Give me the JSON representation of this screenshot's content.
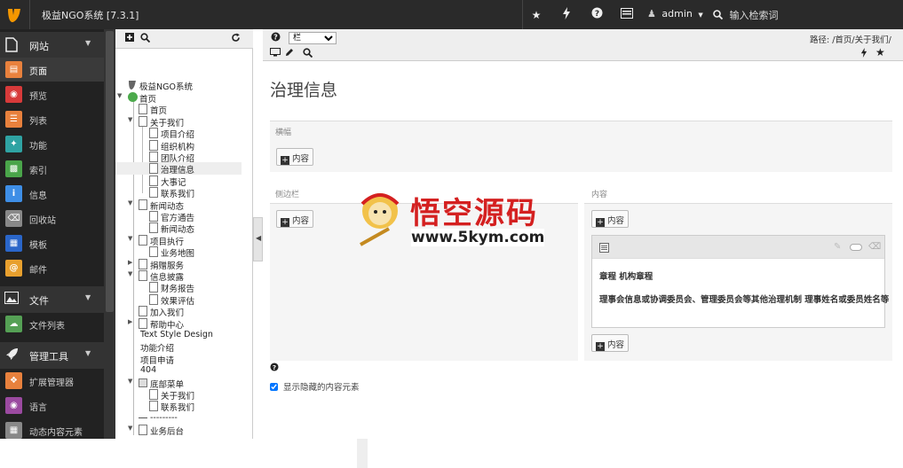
{
  "topbar": {
    "site_title": "极益NGO系统 [7.3.1]",
    "user_label": "admin",
    "search_placeholder": "输入检索词",
    "icons": [
      "star-icon",
      "bolt-icon",
      "help-icon",
      "list-icon",
      "user-icon",
      "search-icon"
    ]
  },
  "modules": {
    "groups": [
      {
        "label": "网站",
        "icon": "file-icon"
      },
      {
        "label": "文件",
        "icon": "image-icon"
      },
      {
        "label": "管理工具",
        "icon": "rocket-icon"
      }
    ],
    "items": [
      {
        "label": "页面",
        "icon": "page-icon",
        "color": "#e8813d",
        "active": true
      },
      {
        "label": "预览",
        "icon": "eye-icon",
        "color": "#d73a3a"
      },
      {
        "label": "列表",
        "icon": "list-icon",
        "color": "#e8813d"
      },
      {
        "label": "功能",
        "icon": "wand-icon",
        "color": "#2fa3a3"
      },
      {
        "label": "索引",
        "icon": "chart-icon",
        "color": "#4aa54a"
      },
      {
        "label": "信息",
        "icon": "info-icon",
        "color": "#3e8ee6"
      },
      {
        "label": "回收站",
        "icon": "trash-icon",
        "color": "#888888"
      },
      {
        "label": "模板",
        "icon": "template-icon",
        "color": "#2a66c9"
      },
      {
        "label": "邮件",
        "icon": "at-icon",
        "color": "#e8a02e"
      },
      {
        "label": "文件列表",
        "icon": "cloud-icon",
        "color": "#55a055"
      },
      {
        "label": "扩展管理器",
        "icon": "ext-icon",
        "color": "#e8813d"
      },
      {
        "label": "语言",
        "icon": "globe-icon",
        "color": "#9b4aa0"
      },
      {
        "label": "动态内容元素",
        "icon": "element-icon",
        "color": "#888888"
      }
    ]
  },
  "tree": {
    "root_label": "极益NGO系统",
    "nodes": [
      {
        "label": "首页"
      },
      {
        "label": "首页"
      },
      {
        "label": "关于我们"
      },
      {
        "label": "项目介绍"
      },
      {
        "label": "组织机构"
      },
      {
        "label": "团队介绍"
      },
      {
        "label": "治理信息"
      },
      {
        "label": "大事记"
      },
      {
        "label": "联系我们"
      },
      {
        "label": "新闻动态"
      },
      {
        "label": "官方通告"
      },
      {
        "label": "新闻动态"
      },
      {
        "label": "项目执行"
      },
      {
        "label": "业务地图"
      },
      {
        "label": "捐赠服务"
      },
      {
        "label": "信息披露"
      },
      {
        "label": "财务报告"
      },
      {
        "label": "效果评估"
      },
      {
        "label": "加入我们"
      },
      {
        "label": "帮助中心"
      },
      {
        "label": "Text Style Design"
      },
      {
        "label": "功能介绍"
      },
      {
        "label": "项目申请"
      },
      {
        "label": "404"
      },
      {
        "label": "底部菜单"
      },
      {
        "label": "关于我们"
      },
      {
        "label": "联系我们"
      },
      {
        "label": "---------"
      },
      {
        "label": "业务后台"
      }
    ]
  },
  "docheader": {
    "select_value": "栏",
    "path": "路径: /首页/关于我们/"
  },
  "content": {
    "title": "治理信息",
    "banner_label": "横幅",
    "sidebar_label": "侧边栏",
    "main_label": "内容",
    "add_label": "内容",
    "element_header": "章程 机构章程",
    "element_text": "理事会信息或协调委员会、管理委员会等其他治理机制 理事姓名或委员姓名等",
    "show_hidden_label": "显示隐藏的内容元素"
  },
  "watermark": {
    "line1": "悟空源码",
    "line2": "www.5kym.com"
  }
}
